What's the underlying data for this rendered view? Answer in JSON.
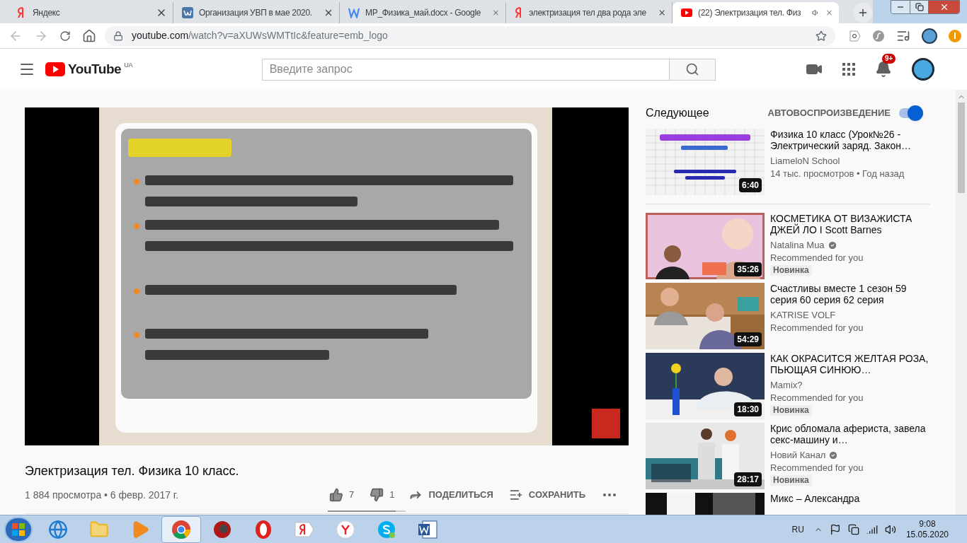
{
  "browser": {
    "tabs": [
      {
        "title": "Яндекс",
        "selected": false,
        "audio": false
      },
      {
        "title": "Организация УВП в мае 2020.",
        "selected": false,
        "audio": false
      },
      {
        "title": "МР_Физика_май.docx - Google",
        "selected": false,
        "audio": false
      },
      {
        "title": "электризация тел два рода эле",
        "selected": false,
        "audio": false
      },
      {
        "title": "(22) Электризация тел. Физ",
        "selected": true,
        "audio": true
      }
    ],
    "address": {
      "host": "youtube.com",
      "path": "/watch?v=aXUWsWMTtIc&feature=emb_logo"
    }
  },
  "header": {
    "logo_text": "YouTube",
    "region": "UA",
    "search": {
      "placeholder": "Введите запрос"
    },
    "notifications": "9+"
  },
  "video": {
    "title": "Электризация тел. Физика 10 класс.",
    "meta": "1 884 просмотра • 6 февр. 2017 г.",
    "likes": "7",
    "dislikes": "1",
    "share": "ПОДЕЛИТЬСЯ",
    "save": "СОХРАНИТЬ",
    "rating": {
      "level": 0.875
    }
  },
  "up_next": {
    "heading": "Следующее",
    "autoplay_label": "АВТОВОСПРОИЗВЕДЕНИЕ",
    "autoplay_on": true
  },
  "recommendations": [
    {
      "title": "Физика 10 класс (Урок№26 - Электрический заряд. Закон…",
      "channel": "LiameloN School",
      "verified": false,
      "line": "14 тыс. просмотров • Год назад",
      "duration": "6:40"
    },
    {
      "title": "КОСМЕТИКА ОТ ВИЗАЖИСТА ДЖЕЙ ЛО I Scott Barnes",
      "channel": "Natalina Mua",
      "verified": true,
      "line": "Recommended for you",
      "badge": "Новинка",
      "duration": "35:26"
    },
    {
      "title": "Счастливы вместе 1 сезон 59 серия 60 серия 62 серия",
      "channel": "KATRISE VOLF",
      "verified": false,
      "line": "Recommended for you",
      "duration": "54:29"
    },
    {
      "title": "КАК ОКРАСИТСЯ ЖЕЛТАЯ РОЗА, ПЬЮЩАЯ СИНЮЮ…",
      "channel": "Mamix?",
      "verified": false,
      "line": "Recommended for you",
      "badge": "Новинка",
      "duration": "18:30"
    },
    {
      "title": "Крис обломала афериста, завела секс-машину и…",
      "channel": "Новий Канал",
      "verified": true,
      "line": "Recommended for you",
      "badge": "Новинка",
      "duration": "28:17"
    },
    {
      "title": "Микс – Александра"
    }
  ],
  "taskbar": {
    "language": "RU",
    "time": "9:08",
    "date": "15.05.2020"
  }
}
